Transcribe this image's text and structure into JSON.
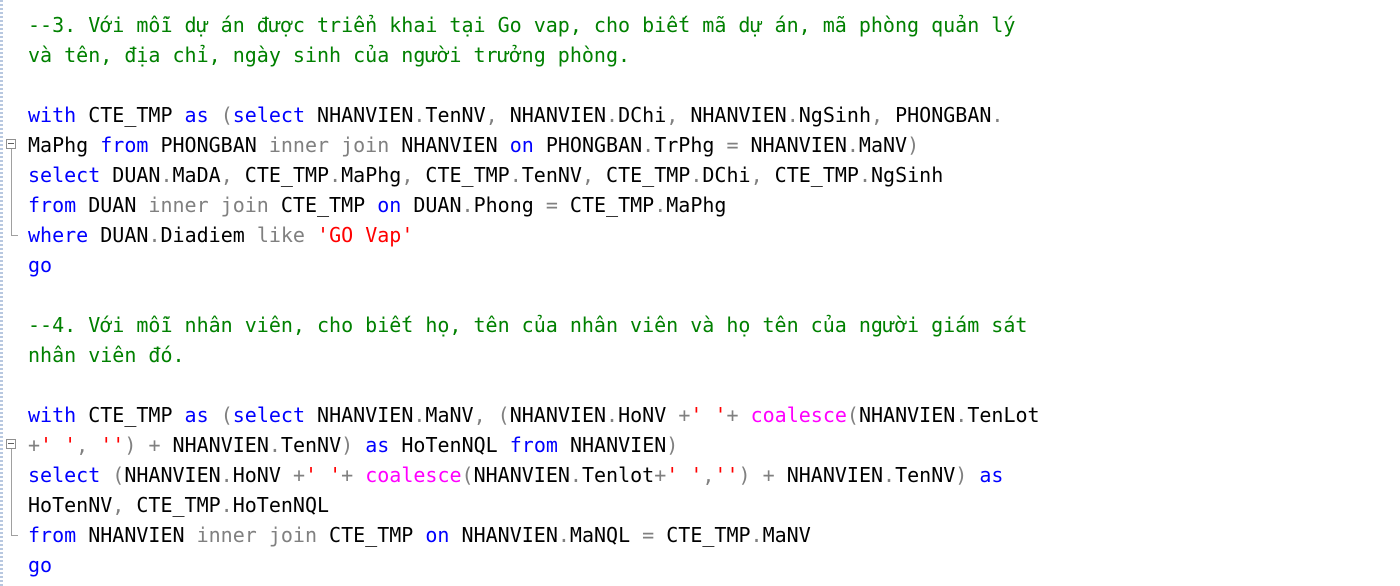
{
  "editor": {
    "lines": [
      {
        "fold": "",
        "tokens": [
          {
            "t": "--3. Với mỗi dự án được triển khai tại Go vap, cho biết mã dự án, mã phòng quản lý",
            "c": "cm"
          }
        ]
      },
      {
        "fold": "",
        "tokens": [
          {
            "t": "và tên, địa chỉ, ngày sinh của người trưởng phòng.",
            "c": "cm"
          }
        ]
      },
      {
        "fold": "",
        "tokens": []
      },
      {
        "fold": "",
        "tokens": [
          {
            "t": "with",
            "c": "kw"
          },
          {
            "t": " CTE_TMP ",
            "c": "plain"
          },
          {
            "t": "as",
            "c": "kw"
          },
          {
            "t": " ",
            "c": "plain"
          },
          {
            "t": "(",
            "c": "op"
          },
          {
            "t": "select",
            "c": "kw"
          },
          {
            "t": " NHANVIEN",
            "c": "plain"
          },
          {
            "t": ".",
            "c": "op"
          },
          {
            "t": "TenNV",
            "c": "plain"
          },
          {
            "t": ",",
            "c": "op"
          },
          {
            "t": " NHANVIEN",
            "c": "plain"
          },
          {
            "t": ".",
            "c": "op"
          },
          {
            "t": "DChi",
            "c": "plain"
          },
          {
            "t": ",",
            "c": "op"
          },
          {
            "t": " NHANVIEN",
            "c": "plain"
          },
          {
            "t": ".",
            "c": "op"
          },
          {
            "t": "NgSinh",
            "c": "plain"
          },
          {
            "t": ",",
            "c": "op"
          },
          {
            "t": " PHONGBAN",
            "c": "plain"
          },
          {
            "t": ".",
            "c": "op"
          }
        ]
      },
      {
        "fold": "box",
        "tokens": [
          {
            "t": "MaPhg ",
            "c": "plain"
          },
          {
            "t": "from",
            "c": "kw"
          },
          {
            "t": " PHONGBAN ",
            "c": "plain"
          },
          {
            "t": "inner join",
            "c": "op"
          },
          {
            "t": " NHANVIEN ",
            "c": "plain"
          },
          {
            "t": "on",
            "c": "kw"
          },
          {
            "t": " PHONGBAN",
            "c": "plain"
          },
          {
            "t": ".",
            "c": "op"
          },
          {
            "t": "TrPhg ",
            "c": "plain"
          },
          {
            "t": "=",
            "c": "op"
          },
          {
            "t": " NHANVIEN",
            "c": "plain"
          },
          {
            "t": ".",
            "c": "op"
          },
          {
            "t": "MaNV",
            "c": "plain"
          },
          {
            "t": ")",
            "c": "op"
          }
        ]
      },
      {
        "fold": "line",
        "tokens": [
          {
            "t": "select",
            "c": "kw"
          },
          {
            "t": " DUAN",
            "c": "plain"
          },
          {
            "t": ".",
            "c": "op"
          },
          {
            "t": "MaDA",
            "c": "plain"
          },
          {
            "t": ",",
            "c": "op"
          },
          {
            "t": " CTE_TMP",
            "c": "plain"
          },
          {
            "t": ".",
            "c": "op"
          },
          {
            "t": "MaPhg",
            "c": "plain"
          },
          {
            "t": ",",
            "c": "op"
          },
          {
            "t": " CTE_TMP",
            "c": "plain"
          },
          {
            "t": ".",
            "c": "op"
          },
          {
            "t": "TenNV",
            "c": "plain"
          },
          {
            "t": ",",
            "c": "op"
          },
          {
            "t": " CTE_TMP",
            "c": "plain"
          },
          {
            "t": ".",
            "c": "op"
          },
          {
            "t": "DChi",
            "c": "plain"
          },
          {
            "t": ",",
            "c": "op"
          },
          {
            "t": " CTE_TMP",
            "c": "plain"
          },
          {
            "t": ".",
            "c": "op"
          },
          {
            "t": "NgSinh",
            "c": "plain"
          }
        ]
      },
      {
        "fold": "line",
        "tokens": [
          {
            "t": "from",
            "c": "kw"
          },
          {
            "t": " DUAN ",
            "c": "plain"
          },
          {
            "t": "inner join",
            "c": "op"
          },
          {
            "t": " CTE_TMP ",
            "c": "plain"
          },
          {
            "t": "on",
            "c": "kw"
          },
          {
            "t": " DUAN",
            "c": "plain"
          },
          {
            "t": ".",
            "c": "op"
          },
          {
            "t": "Phong ",
            "c": "plain"
          },
          {
            "t": "=",
            "c": "op"
          },
          {
            "t": " CTE_TMP",
            "c": "plain"
          },
          {
            "t": ".",
            "c": "op"
          },
          {
            "t": "MaPhg",
            "c": "plain"
          }
        ]
      },
      {
        "fold": "end",
        "tokens": [
          {
            "t": "where",
            "c": "kw"
          },
          {
            "t": " DUAN",
            "c": "plain"
          },
          {
            "t": ".",
            "c": "op"
          },
          {
            "t": "Diadiem ",
            "c": "plain"
          },
          {
            "t": "like",
            "c": "op"
          },
          {
            "t": " ",
            "c": "plain"
          },
          {
            "t": "'GO Vap'",
            "c": "str"
          }
        ]
      },
      {
        "fold": "",
        "tokens": [
          {
            "t": "go",
            "c": "kw"
          }
        ]
      },
      {
        "fold": "",
        "tokens": []
      },
      {
        "fold": "",
        "tokens": [
          {
            "t": "--4. Với mỗi nhân viên, cho biết họ, tên của nhân viên và họ tên của người giám sát",
            "c": "cm"
          }
        ]
      },
      {
        "fold": "",
        "tokens": [
          {
            "t": "nhân viên đó.",
            "c": "cm"
          }
        ]
      },
      {
        "fold": "",
        "tokens": []
      },
      {
        "fold": "",
        "tokens": [
          {
            "t": "with",
            "c": "kw"
          },
          {
            "t": " CTE_TMP ",
            "c": "plain"
          },
          {
            "t": "as",
            "c": "kw"
          },
          {
            "t": " ",
            "c": "plain"
          },
          {
            "t": "(",
            "c": "op"
          },
          {
            "t": "select",
            "c": "kw"
          },
          {
            "t": " NHANVIEN",
            "c": "plain"
          },
          {
            "t": ".",
            "c": "op"
          },
          {
            "t": "MaNV",
            "c": "plain"
          },
          {
            "t": ",",
            "c": "op"
          },
          {
            "t": " ",
            "c": "plain"
          },
          {
            "t": "(",
            "c": "op"
          },
          {
            "t": "NHANVIEN",
            "c": "plain"
          },
          {
            "t": ".",
            "c": "op"
          },
          {
            "t": "HoNV ",
            "c": "plain"
          },
          {
            "t": "+",
            "c": "op"
          },
          {
            "t": "' '",
            "c": "str"
          },
          {
            "t": "+",
            "c": "op"
          },
          {
            "t": " ",
            "c": "plain"
          },
          {
            "t": "coalesce",
            "c": "fn"
          },
          {
            "t": "(",
            "c": "op"
          },
          {
            "t": "NHANVIEN",
            "c": "plain"
          },
          {
            "t": ".",
            "c": "op"
          },
          {
            "t": "TenLot",
            "c": "plain"
          }
        ]
      },
      {
        "fold": "box",
        "tokens": [
          {
            "t": "+",
            "c": "op"
          },
          {
            "t": "' '",
            "c": "str"
          },
          {
            "t": ",",
            "c": "op"
          },
          {
            "t": " ",
            "c": "plain"
          },
          {
            "t": "''",
            "c": "str"
          },
          {
            "t": ")",
            "c": "op"
          },
          {
            "t": " ",
            "c": "plain"
          },
          {
            "t": "+",
            "c": "op"
          },
          {
            "t": " NHANVIEN",
            "c": "plain"
          },
          {
            "t": ".",
            "c": "op"
          },
          {
            "t": "TenNV",
            "c": "plain"
          },
          {
            "t": ")",
            "c": "op"
          },
          {
            "t": " ",
            "c": "plain"
          },
          {
            "t": "as",
            "c": "kw"
          },
          {
            "t": " HoTenNQL ",
            "c": "plain"
          },
          {
            "t": "from",
            "c": "kw"
          },
          {
            "t": " NHANVIEN",
            "c": "plain"
          },
          {
            "t": ")",
            "c": "op"
          }
        ]
      },
      {
        "fold": "line",
        "tokens": [
          {
            "t": "select",
            "c": "kw"
          },
          {
            "t": " ",
            "c": "plain"
          },
          {
            "t": "(",
            "c": "op"
          },
          {
            "t": "NHANVIEN",
            "c": "plain"
          },
          {
            "t": ".",
            "c": "op"
          },
          {
            "t": "HoNV ",
            "c": "plain"
          },
          {
            "t": "+",
            "c": "op"
          },
          {
            "t": "' '",
            "c": "str"
          },
          {
            "t": "+",
            "c": "op"
          },
          {
            "t": " ",
            "c": "plain"
          },
          {
            "t": "coalesce",
            "c": "fn"
          },
          {
            "t": "(",
            "c": "op"
          },
          {
            "t": "NHANVIEN",
            "c": "plain"
          },
          {
            "t": ".",
            "c": "op"
          },
          {
            "t": "Tenlot",
            "c": "plain"
          },
          {
            "t": "+",
            "c": "op"
          },
          {
            "t": "' '",
            "c": "str"
          },
          {
            "t": ",",
            "c": "op"
          },
          {
            "t": "''",
            "c": "str"
          },
          {
            "t": ")",
            "c": "op"
          },
          {
            "t": " ",
            "c": "plain"
          },
          {
            "t": "+",
            "c": "op"
          },
          {
            "t": " NHANVIEN",
            "c": "plain"
          },
          {
            "t": ".",
            "c": "op"
          },
          {
            "t": "TenNV",
            "c": "plain"
          },
          {
            "t": ")",
            "c": "op"
          },
          {
            "t": " ",
            "c": "plain"
          },
          {
            "t": "as",
            "c": "kw"
          }
        ]
      },
      {
        "fold": "line",
        "tokens": [
          {
            "t": "HoTenNV",
            "c": "plain"
          },
          {
            "t": ",",
            "c": "op"
          },
          {
            "t": " CTE_TMP",
            "c": "plain"
          },
          {
            "t": ".",
            "c": "op"
          },
          {
            "t": "HoTenNQL",
            "c": "plain"
          }
        ]
      },
      {
        "fold": "end",
        "tokens": [
          {
            "t": "from",
            "c": "kw"
          },
          {
            "t": " NHANVIEN ",
            "c": "plain"
          },
          {
            "t": "inner join",
            "c": "op"
          },
          {
            "t": " CTE_TMP ",
            "c": "plain"
          },
          {
            "t": "on",
            "c": "kw"
          },
          {
            "t": " NHANVIEN",
            "c": "plain"
          },
          {
            "t": ".",
            "c": "op"
          },
          {
            "t": "MaNQL ",
            "c": "plain"
          },
          {
            "t": "=",
            "c": "op"
          },
          {
            "t": " CTE_TMP",
            "c": "plain"
          },
          {
            "t": ".",
            "c": "op"
          },
          {
            "t": "MaNV",
            "c": "plain"
          }
        ]
      },
      {
        "fold": "",
        "tokens": [
          {
            "t": "go",
            "c": "kw"
          }
        ]
      }
    ],
    "colors": {
      "keyword": "#0000ff",
      "function": "#ff00ff",
      "operator": "#808080",
      "string": "#ff0000",
      "comment": "#008000",
      "text": "#000000",
      "background": "#ffffff"
    },
    "icons": {
      "fold_collapse": "minus-box-icon"
    }
  }
}
